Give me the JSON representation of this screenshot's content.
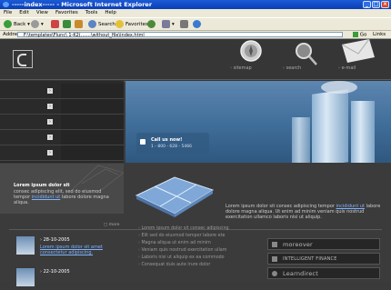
{
  "browser": {
    "title": "-----index----- - Microsoft Internet Explorer",
    "menu": [
      "File",
      "Edit",
      "View",
      "Favorites",
      "Tools",
      "Help"
    ],
    "back_label": "Back",
    "search_label": "Search",
    "favorites_label": "Favorites",
    "address_label": "Address",
    "address_value": "F:\\templates\\Flunc\\ 1-K2(.......\\without_file\\index.html",
    "go_label": "Go",
    "links_label": "Links"
  },
  "header": {
    "nav": [
      "sitemap",
      "search",
      "e-mail"
    ]
  },
  "banner": {
    "call_title": "Call us now!",
    "call_number": "1 - 800 - 628 - 5466"
  },
  "intro": {
    "heading": "Lorem ipsum dolor sit",
    "text_before": "consec adipiscing elit, sed do eiusmod tempor ",
    "link": "incididunt ut",
    "text_after": " labore dolore magna aliqua.",
    "more_label": "more"
  },
  "middle": {
    "text_before": "Lorem ipsum dolor sit consec adipiscing tempor ",
    "link": "incididunt ut",
    "text_after": " labore dolore magna aliqua. Ut enim ad minim veniam quis nostrud exercitation ullamco laboris nisi ut aliquip."
  },
  "news": [
    {
      "date": "28-10-2005",
      "text": "Lorem ipsum dolor sit amet consectetur adipiscing."
    },
    {
      "date": "22-10-2005",
      "text": ""
    }
  ],
  "list": [
    "Lorem ipsum dolor sit consec adipiscing",
    "Elit sed do eiusmod tempor labore ete",
    "Magna aliqua ut enim ad minim",
    "Veniam quis nostrud exercitation ullam",
    "Laboris nisi ut aliquip ex ea commodo",
    "Consequat duis aute irure dolor"
  ],
  "partners": [
    "moreover",
    "INTELLIGENT FINANCE",
    "Learndirect"
  ]
}
